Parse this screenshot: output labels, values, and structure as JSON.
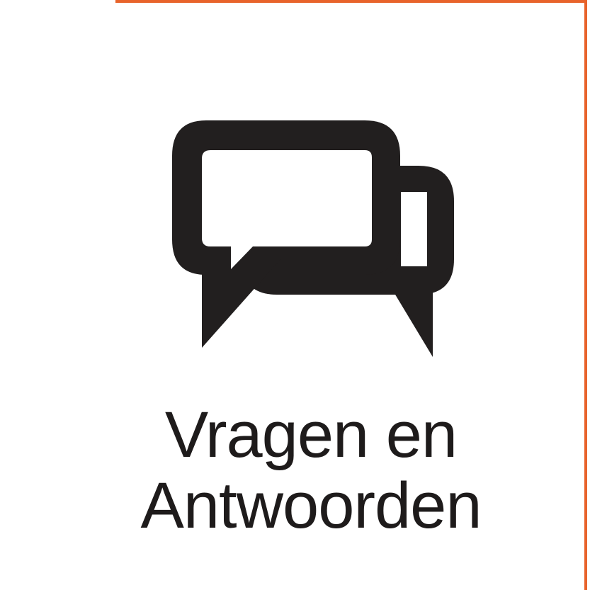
{
  "tile": {
    "icon": "chat-bubbles-icon",
    "label_line1": "Vragen en",
    "label_line2": "Antwoorden",
    "accent_color": "#e8632b",
    "icon_color": "#221f1f"
  }
}
